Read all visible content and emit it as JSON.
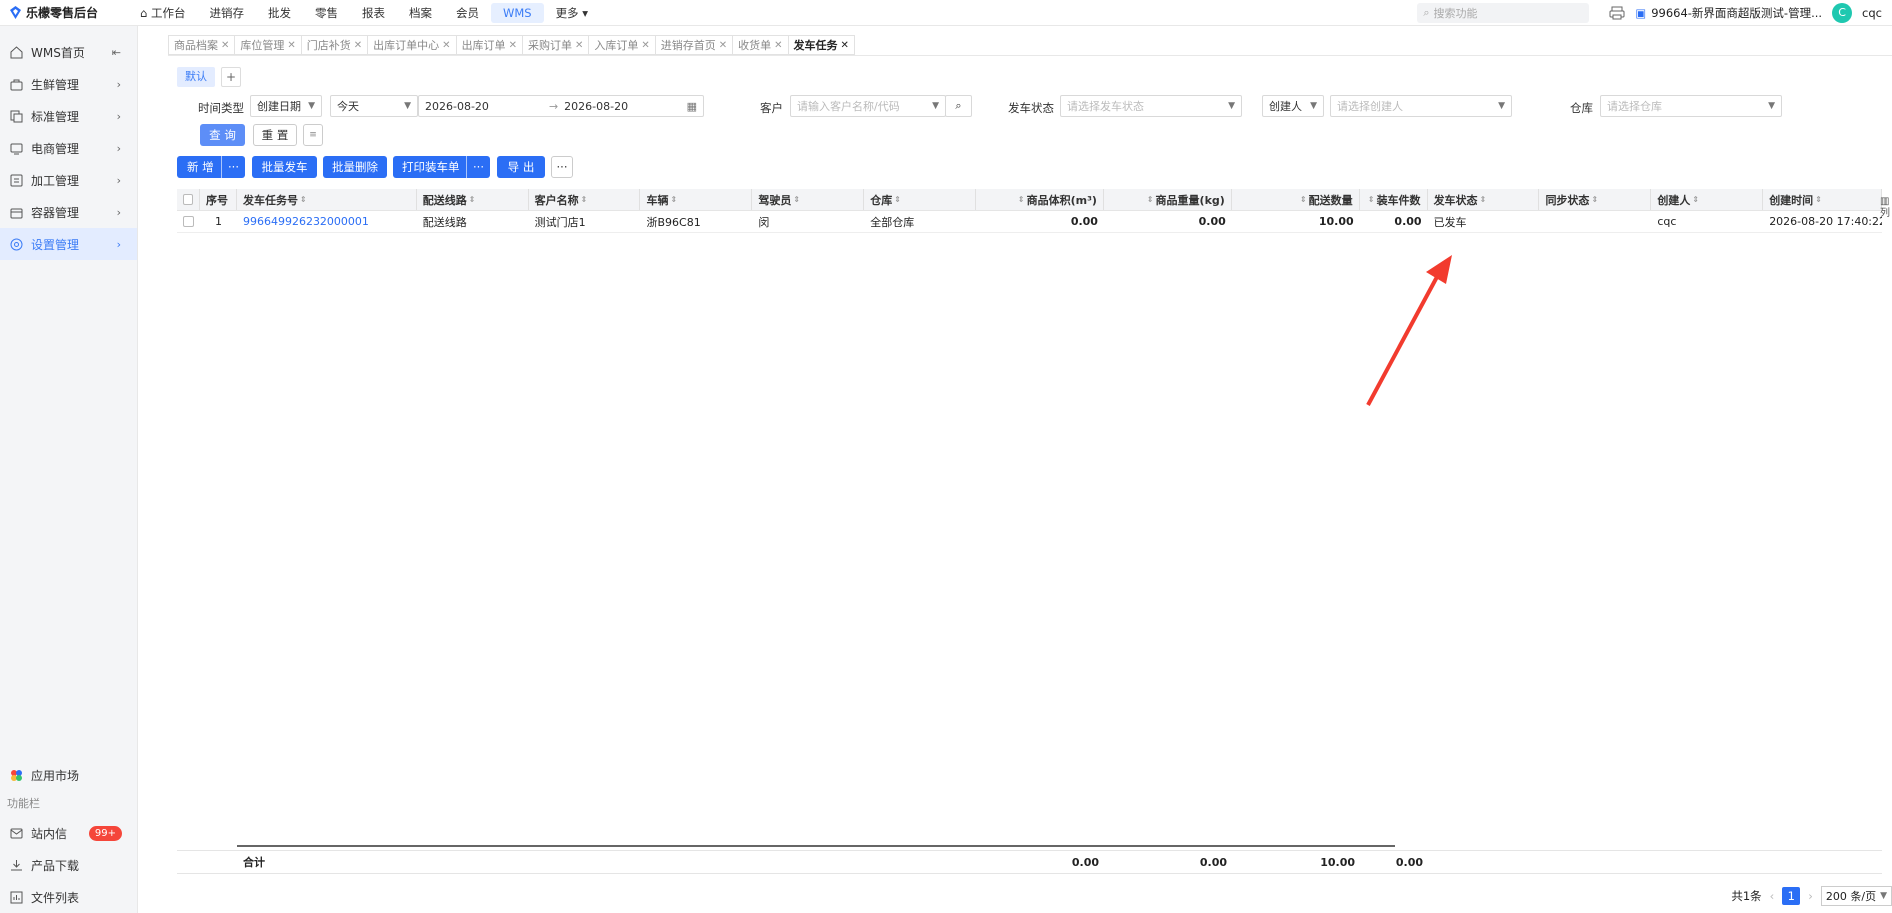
{
  "topbar": {
    "app_name": "乐檬零售后台",
    "nav": [
      "工作台",
      "进销存",
      "批发",
      "零售",
      "报表",
      "档案",
      "会员",
      "WMS",
      "更多"
    ],
    "active_nav": "WMS",
    "search_placeholder": "搜索功能",
    "store": "99664-新界面商超版测试-管理...",
    "user_initial": "C",
    "user": "cqc"
  },
  "sidebar": {
    "items": [
      {
        "label": "WMS首页",
        "icon": "home-icon"
      },
      {
        "label": "生鲜管理",
        "icon": "basket-icon"
      },
      {
        "label": "标准管理",
        "icon": "copy-icon"
      },
      {
        "label": "电商管理",
        "icon": "tv-icon"
      },
      {
        "label": "加工管理",
        "icon": "process-icon"
      },
      {
        "label": "容器管理",
        "icon": "container-icon"
      },
      {
        "label": "设置管理",
        "icon": "settings-icon"
      }
    ],
    "bottom": {
      "market": "应用市场",
      "section": "功能栏",
      "messages": "站内信",
      "badge": "99+",
      "download": "产品下载",
      "files": "文件列表"
    }
  },
  "tabs": [
    "商品档案",
    "库位管理",
    "门店补货",
    "出库订单中心",
    "出库订单",
    "采购订单",
    "入库订单",
    "进销存首页",
    "收货单",
    "发车任务"
  ],
  "view": {
    "tab": "默认",
    "add": "+"
  },
  "filters": {
    "time_type_label": "时间类型",
    "time_type": "创建日期",
    "range": "今天",
    "date_from": "2026-08-20",
    "date_to": "2026-08-20",
    "arrow": "→",
    "customer_label": "客户",
    "customer_ph": "请输入客户名称/代码",
    "status_label": "发车状态",
    "status_ph": "请选择发车状态",
    "creator_type": "创建人",
    "creator_ph": "请选择创建人",
    "warehouse_label": "仓库",
    "warehouse_ph": "请选择仓库",
    "query": "查 询",
    "reset": "重 置"
  },
  "actions": {
    "new": "新 增",
    "batch_depart": "批量发车",
    "batch_delete": "批量删除",
    "print": "打印装车单",
    "export": "导 出",
    "more": "···"
  },
  "table": {
    "headers": [
      "序号",
      "发车任务号",
      "配送线路",
      "客户名称",
      "车辆",
      "驾驶员",
      "仓库",
      "商品体积(m³)",
      "商品重量(kg)",
      "配送数量",
      "装车件数",
      "发车状态",
      "同步状态",
      "创建人",
      "创建时间"
    ],
    "rows": [
      [
        "1",
        "996649926232000001",
        "配送线路",
        "测试门店1",
        "浙B96C81",
        "闵",
        "全部仓库",
        "0.00",
        "0.00",
        "10.00",
        "0.00",
        "已发车",
        "",
        "cqc",
        "2026-08-20 17:40:22"
      ]
    ],
    "summary": {
      "label": "合计",
      "volume": "0.00",
      "weight": "0.00",
      "qty": "10.00",
      "pieces": "0.00"
    },
    "column_setting": "列"
  },
  "pager": {
    "total": "共1条",
    "page": "1",
    "size": "200 条/页",
    "prev": "‹",
    "next": "›"
  },
  "colors": {
    "primary": "#2b6ef5",
    "arrow": "#f23b2e"
  }
}
